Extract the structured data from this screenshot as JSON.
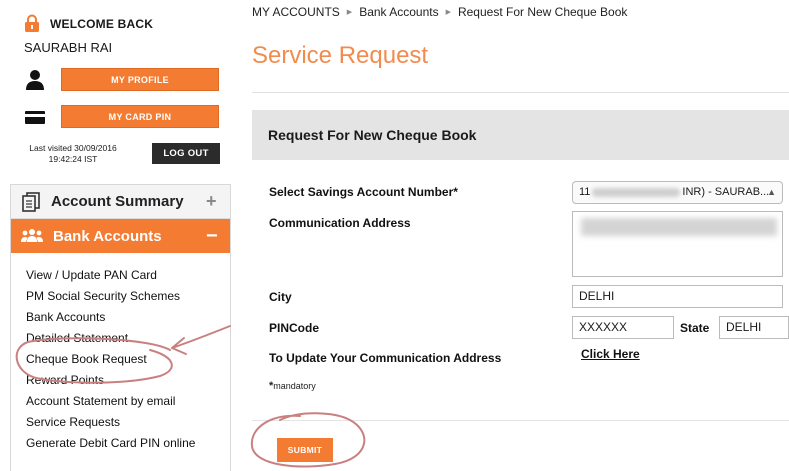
{
  "sidebar": {
    "welcome": "WELCOME BACK",
    "user_name": "SAURABH RAI",
    "my_profile_label": "MY PROFILE",
    "my_card_pin_label": "MY CARD PIN",
    "last_visited": "Last visited 30/09/2016 19:42:24 IST",
    "logout_label": "LOG OUT",
    "account_summary_label": "Account Summary",
    "bank_accounts_label": "Bank Accounts",
    "submenu": [
      "View / Update PAN Card",
      "PM Social Security Schemes",
      "Bank Accounts",
      "Detailed Statement",
      "Cheque Book Request",
      "Reward Points",
      "Account Statement by email",
      "Service Requests",
      "Generate Debit Card PIN online"
    ]
  },
  "breadcrumb": [
    "MY ACCOUNTS",
    "Bank Accounts",
    "Request For New Cheque Book"
  ],
  "page_title": "Service Request",
  "form": {
    "heading": "Request For New Cheque Book",
    "account_label": "Select Savings Account Number*",
    "account_value_start": "11",
    "account_value_end": "INR) - SAURAB...",
    "address_label": "Communication Address",
    "city_label": "City",
    "city_value": "DELHI",
    "pincode_label": "PINCode",
    "pincode_value": "XXXXXX",
    "state_label": "State",
    "state_value": "DELHI",
    "update_address_label": "To Update Your Communication Address",
    "click_here_label": "Click Here",
    "mandatory_note": "mandatory",
    "submit_label": "SUBMIT"
  },
  "colors": {
    "accent_orange": "#f47b32",
    "title_orange": "#f28b4e",
    "annotation_red": "#c98080"
  },
  "icons": [
    "lock-icon",
    "profile-icon",
    "card-icon",
    "document-icon",
    "users-icon",
    "plus-icon",
    "minus-icon",
    "select-arrow-icon"
  ]
}
